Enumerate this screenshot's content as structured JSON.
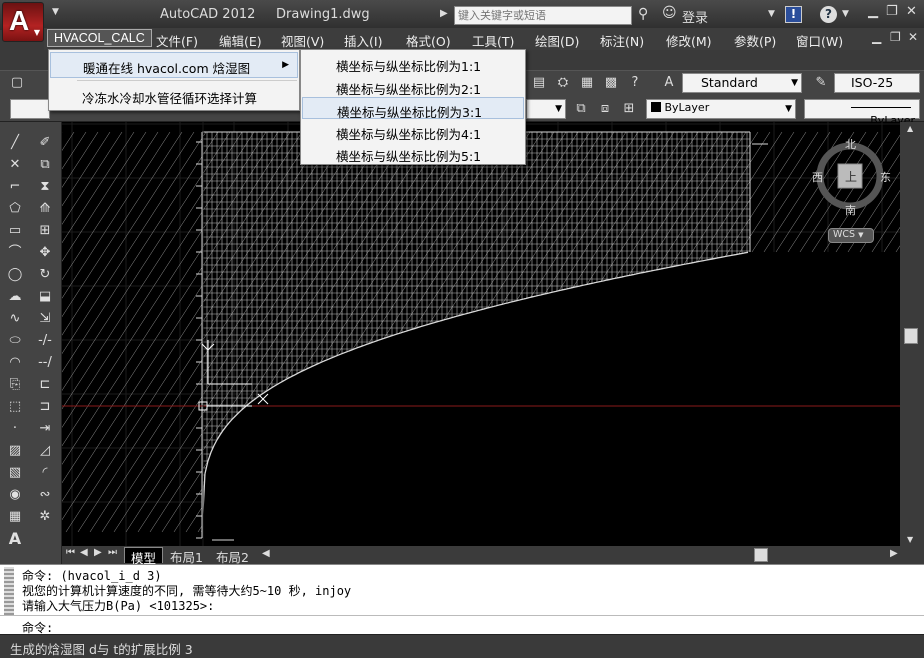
{
  "titlebar": {
    "app_title": "AutoCAD 2012     Drawing1.dwg",
    "search_placeholder": "键入关键字或短语",
    "login_label": "登录",
    "help_label": "?",
    "exchange_label": "!",
    "minimize": "▁",
    "restore": "❐",
    "close": "✕"
  },
  "menubar": {
    "items": [
      {
        "label": "HVACOL_CALC"
      },
      {
        "label": "文件(F)"
      },
      {
        "label": "编辑(E)"
      },
      {
        "label": "视图(V)"
      },
      {
        "label": "插入(I)"
      },
      {
        "label": "格式(O)"
      },
      {
        "label": "工具(T)"
      },
      {
        "label": "绘图(D)"
      },
      {
        "label": "标注(N)"
      },
      {
        "label": "修改(M)"
      },
      {
        "label": "参数(P)"
      },
      {
        "label": "窗口(W)"
      }
    ],
    "mdi_min": "▁",
    "mdi_restore": "❐",
    "mdi_close": "✕"
  },
  "dropdown": {
    "items": [
      {
        "label": "暖通在线 hvacol.com 焓湿图"
      },
      {
        "label": "冷冻水冷却水管径循环选择计算"
      }
    ]
  },
  "submenu": {
    "items": [
      {
        "label": "横坐标与纵坐标比例为1:1"
      },
      {
        "label": "横坐标与纵坐标比例为2:1"
      },
      {
        "label": "横坐标与纵坐标比例为3:1"
      },
      {
        "label": "横坐标与纵坐标比例为4:1"
      },
      {
        "label": "横坐标与纵坐标比例为5:1"
      }
    ],
    "highlighted_index": 2
  },
  "toolbar": {
    "text_style": "Standard",
    "dim_style": "ISO-25",
    "layer_color": "ByLayer",
    "linetype": "ByLayer"
  },
  "compass": {
    "north": "北",
    "south": "南",
    "east": "东",
    "west": "西",
    "top": "上",
    "wcs": "WCS"
  },
  "layout_tabs": [
    {
      "label": "模型"
    },
    {
      "label": "布局1"
    },
    {
      "label": "布局2"
    }
  ],
  "command": {
    "history": [
      "命令: (hvacol_i_d 3)",
      "视您的计算机计算速度的不同, 需等待大约5~10 秒, injoy",
      "请输入大气压力B(Pa) <101325>:"
    ],
    "prompt": "命令:"
  },
  "status": {
    "text": "生成的焓湿图 d与 t的扩展比例 3"
  },
  "colors": {
    "canvas_bg": "#000000",
    "chart_lines": "#d8d8d8",
    "crosshair_h": "#8a1a1a",
    "menu_highlight": "#e3ebf5"
  }
}
